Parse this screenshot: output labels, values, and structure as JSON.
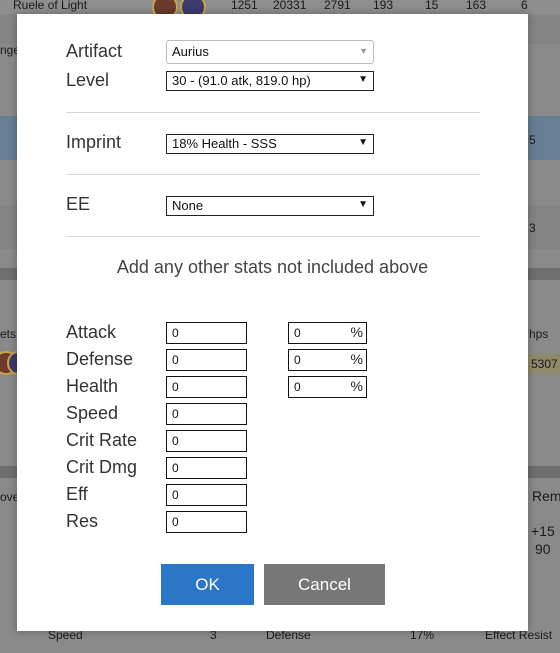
{
  "background": {
    "top_row": {
      "name": "Ruele of Light",
      "values": [
        "1251",
        "20331",
        "2791",
        "193",
        "15",
        "163",
        "6"
      ]
    },
    "left_fragments": [
      "nge",
      "ets",
      "ove"
    ],
    "right_fragments": [
      "5",
      "3",
      "hps",
      "5307",
      "Rem",
      "+15",
      "90"
    ],
    "bottom_row": {
      "speed_label": "Speed",
      "speed_value": "3",
      "defense_label": "Defense",
      "defense_value": "17%",
      "effect_resist_label": "Effect Resist"
    }
  },
  "modal": {
    "artifact_label": "Artifact",
    "artifact_value": "Aurius",
    "level_label": "Level",
    "level_value": "30 - (91.0 atk, 819.0 hp)",
    "imprint_label": "Imprint",
    "imprint_value": "18% Health - SSS",
    "ee_label": "EE",
    "ee_value": "None",
    "note": "Add any other stats not included above",
    "stats": [
      {
        "label": "Attack",
        "value": "0",
        "pct": "0"
      },
      {
        "label": "Defense",
        "value": "0",
        "pct": "0"
      },
      {
        "label": "Health",
        "value": "0",
        "pct": "0"
      },
      {
        "label": "Speed",
        "value": "0"
      },
      {
        "label": "Crit Rate",
        "value": "0"
      },
      {
        "label": "Crit Dmg",
        "value": "0"
      },
      {
        "label": "Eff",
        "value": "0"
      },
      {
        "label": "Res",
        "value": "0"
      }
    ],
    "pct_symbol": "%",
    "ok_label": "OK",
    "cancel_label": "Cancel"
  },
  "colors": {
    "ok_button": "#2c76c8",
    "cancel_button": "#777777"
  }
}
